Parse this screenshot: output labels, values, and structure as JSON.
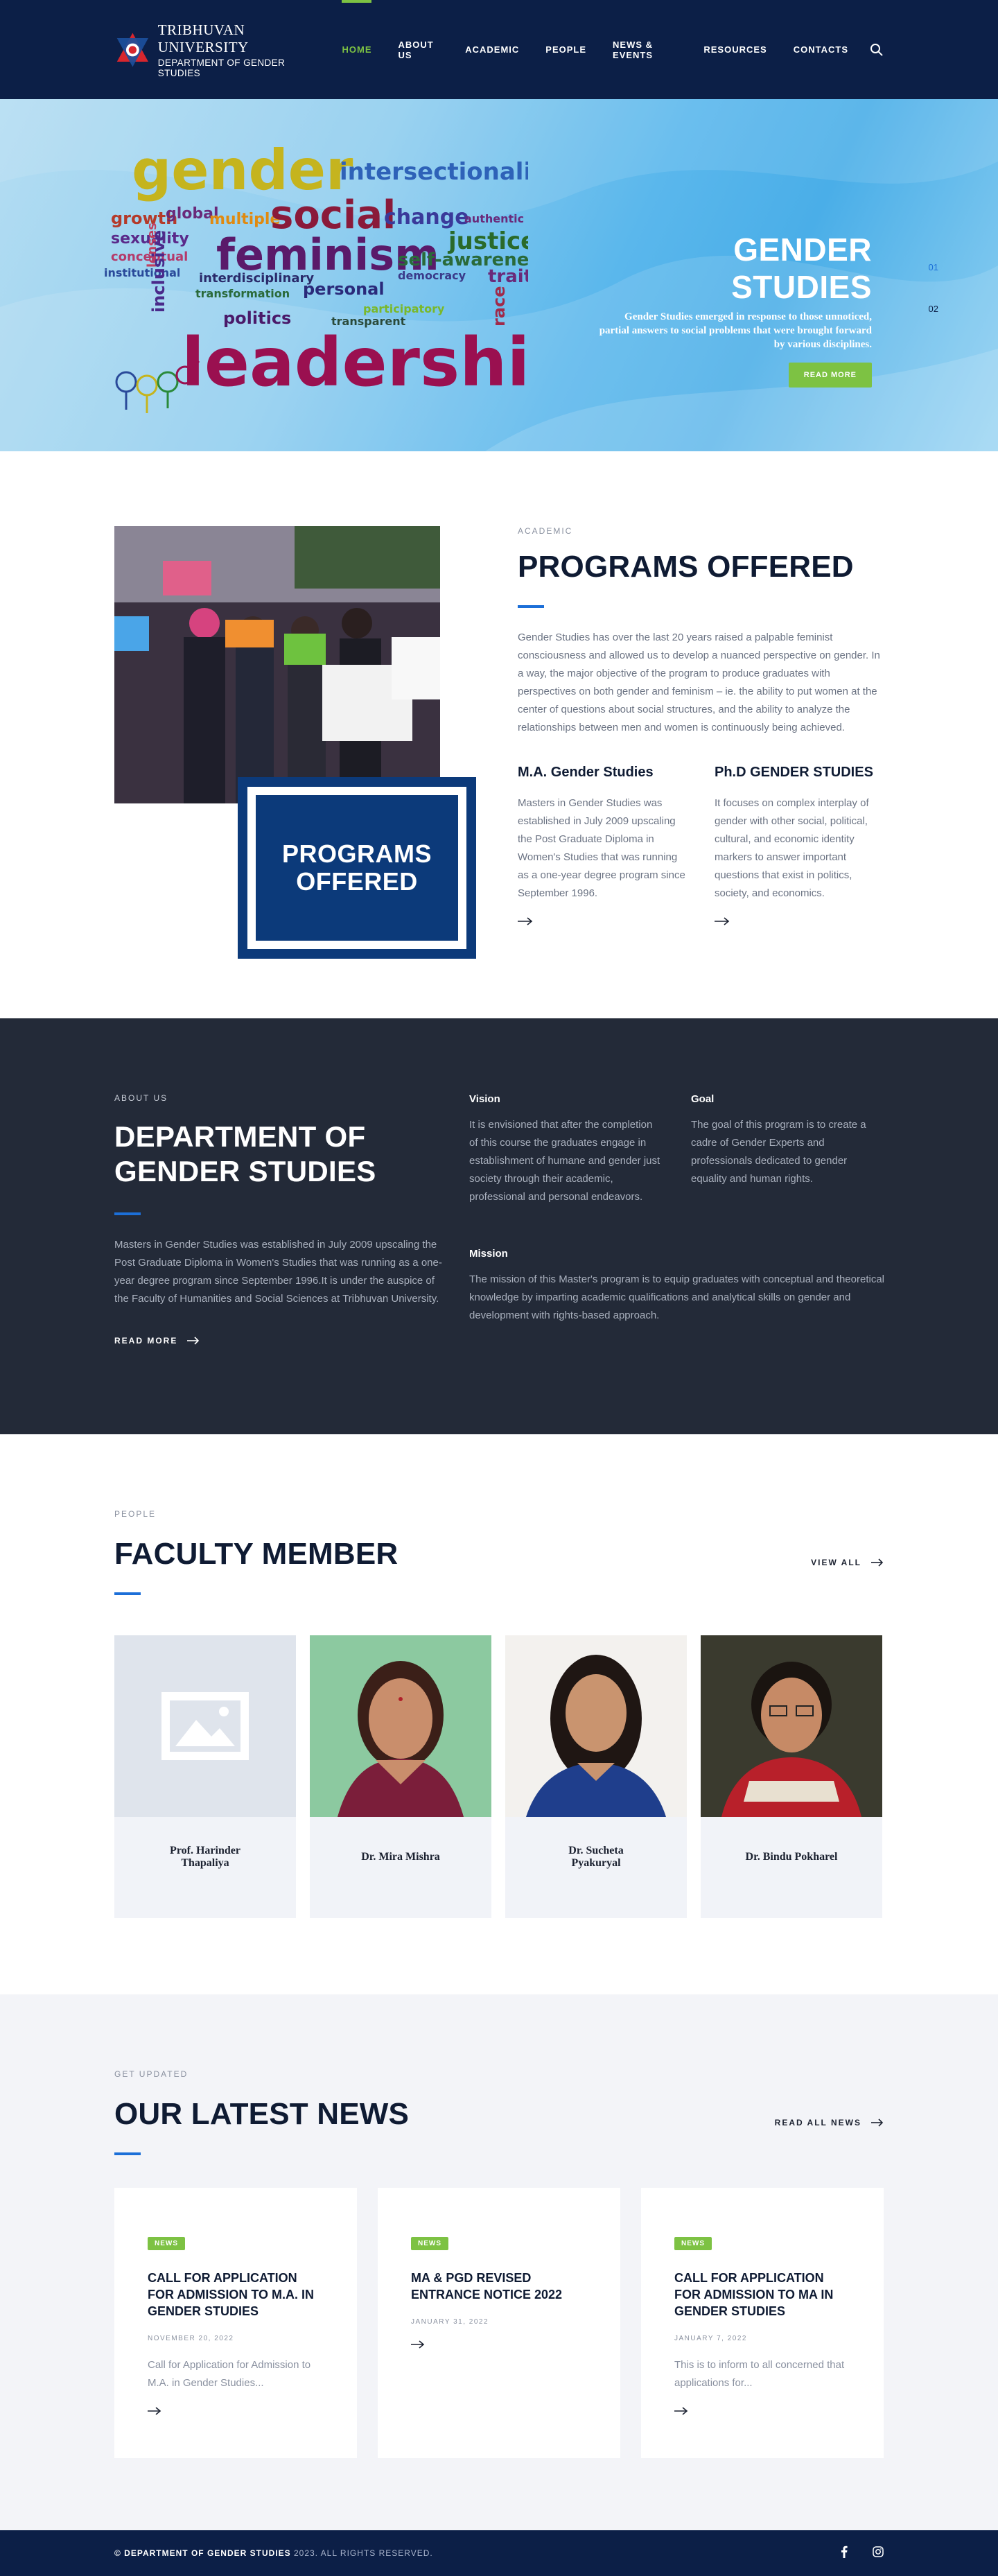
{
  "header": {
    "logo_line1": "TRIBHUVAN UNIVERSITY",
    "logo_line2": "DEPARTMENT OF GENDER STUDIES",
    "nav": [
      {
        "label": "HOME",
        "active": true
      },
      {
        "label": "ABOUT US"
      },
      {
        "label": "ACADEMIC"
      },
      {
        "label": "PEOPLE"
      },
      {
        "label": "NEWS & EVENTS"
      },
      {
        "label": "RESOURCES"
      },
      {
        "label": "CONTACTS"
      }
    ],
    "search_icon": "search-icon"
  },
  "hero": {
    "words": [
      "gender",
      "intersectionality",
      "growth",
      "global",
      "multiple",
      "social",
      "change",
      "sexuality",
      "lenses",
      "authentic",
      "justice",
      "conceptual",
      "feminism",
      "self-awareness",
      "institutional",
      "inclusive",
      "interdisciplinary",
      "democracy",
      "trait",
      "transformation",
      "personal",
      "race",
      "politics",
      "participatory",
      "transparent",
      "leadership"
    ],
    "title": "GENDER STUDIES",
    "description": "Gender Studies emerged in response to those unnoticed, partial answers to social problems that were brought forward by various disciplines.",
    "button": "READ MORE",
    "slides": [
      "01",
      "02"
    ]
  },
  "programs": {
    "eyebrow": "ACADEMIC",
    "title": "PROGRAMS OFFERED",
    "box_line1": "PROGRAMS",
    "box_line2": "OFFERED",
    "intro": "Gender Studies has over the last 20 years raised a palpable feminist consciousness and allowed us to develop a nuanced perspective on gender. In a way, the major objective of the program to produce graduates with perspectives on both gender and feminism – ie. the ability to put women at the center of questions about social structures, and the ability to analyze the relationships between men and women is continuously being achieved.",
    "ma_title": "M.A. Gender Studies",
    "ma_text": "Masters in Gender Studies was established in July 2009 upscaling the Post Graduate Diploma in Women's Studies that was running as a one-year degree program since September 1996.",
    "phd_title": "Ph.D GENDER STUDIES",
    "phd_text": "It focuses on complex interplay of gender with other social, political, cultural, and economic identity markers to answer important questions that exist in politics, society, and economics."
  },
  "about": {
    "eyebrow": "ABOUT US",
    "title_line1": "DEPARTMENT OF",
    "title_line2": "GENDER STUDIES",
    "text": "Masters in Gender Studies was established in July 2009 upscaling the Post Graduate Diploma in Women's Studies that was running as a one-year degree program since September 1996.It is under the auspice of the Faculty of Humanities and Social Sciences at Tribhuvan University.",
    "read_more": "READ MORE",
    "vision_title": "Vision",
    "vision_text": "It is envisioned that after the completion of this course the graduates engage in establishment of humane and gender just society through their academic, professional and personal endeavors.",
    "goal_title": "Goal",
    "goal_text": "The goal of this program is to create a cadre of Gender Experts and professionals dedicated to gender equality and human rights.",
    "mission_title": "Mission",
    "mission_text": "The mission of this Master's program is to equip graduates with conceptual and theoretical knowledge by imparting academic qualifications and analytical skills on gender and development with rights-based approach."
  },
  "faculty": {
    "eyebrow": "PEOPLE",
    "title": "FACULTY MEMBER",
    "view_all": "VIEW ALL",
    "members": [
      {
        "name": "Prof. Harinder Thapaliya"
      },
      {
        "name": "Dr. Mira Mishra"
      },
      {
        "name": "Dr. Sucheta Pyakuryal"
      },
      {
        "name": "Dr. Bindu Pokharel"
      }
    ]
  },
  "news": {
    "eyebrow": "GET UPDATED",
    "title": "OUR LATEST NEWS",
    "read_all": "READ ALL NEWS",
    "items": [
      {
        "badge": "NEWS",
        "title": "CALL FOR APPLICATION FOR ADMISSION TO M.A. IN GENDER STUDIES",
        "date": "NOVEMBER 20, 2022",
        "excerpt": "Call for Application for Admission to M.A. in Gender Studies..."
      },
      {
        "badge": "NEWS",
        "title": "MA & PGD REVISED ENTRANCE NOTICE 2022",
        "date": "JANUARY 31, 2022",
        "excerpt": ""
      },
      {
        "badge": "NEWS",
        "title": "CALL FOR APPLICATION FOR ADMISSION TO MA IN GENDER STUDIES",
        "date": "JANUARY 7, 2022",
        "excerpt": "This is to inform to all concerned that applications for..."
      }
    ]
  },
  "footer": {
    "copy_name": "© DEPARTMENT OF GENDER STUDIES",
    "copy_rest": " 2023. ALL RIGHTS RESERVED.",
    "social": [
      "facebook-icon",
      "instagram-icon"
    ]
  },
  "colors": {
    "navy": "#0c1f47",
    "accent_green": "#7dc243",
    "accent_blue": "#1c6fd8",
    "dark_section": "#232a38"
  }
}
